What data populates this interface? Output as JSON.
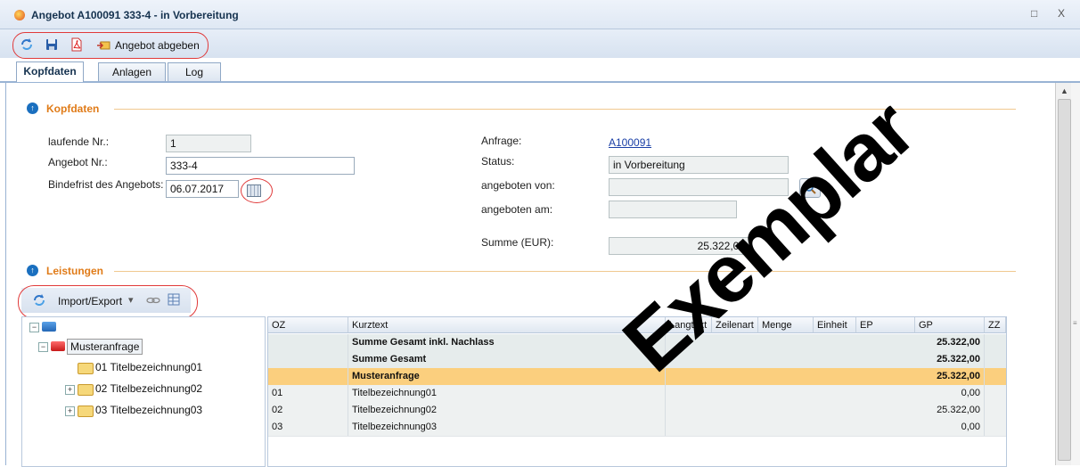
{
  "window": {
    "title": "Angebot A100091 333-4 - in Vorbereitung",
    "restore_glyph": "□",
    "close_glyph": "X"
  },
  "toolbar": {
    "submit_label": "Angebot abgeben",
    "icons": [
      "refresh-icon",
      "save-icon",
      "pdf-icon",
      "submit-offer-icon"
    ]
  },
  "tabs": [
    {
      "label": "Kopfdaten",
      "active": true
    },
    {
      "label": "Anlagen",
      "active": false
    },
    {
      "label": "Log",
      "active": false
    }
  ],
  "kopfdaten": {
    "section_title": "Kopfdaten",
    "laufende_nr_label": "laufende Nr.:",
    "laufende_nr_value": "1",
    "angebot_nr_label": "Angebot Nr.:",
    "angebot_nr_value": "333-4",
    "bindefrist_label": "Bindefrist des Angebots:",
    "bindefrist_value": "06.07.2017",
    "anfrage_label": "Anfrage:",
    "anfrage_value": "A100091",
    "status_label": "Status:",
    "status_value": "in Vorbereitung",
    "angeboten_von_label": "angeboten von:",
    "angeboten_von_value": "",
    "angeboten_am_label": "angeboten am:",
    "angeboten_am_value": "",
    "summe_label": "Summe (EUR):",
    "summe_value": "25.322,00"
  },
  "leistungen": {
    "section_title": "Leistungen",
    "import_export_label": "Import/Export",
    "dropdown_glyph": "▾",
    "tree": {
      "root_label": "Musteranfrage",
      "children": [
        "01 Titelbezeichnung01",
        "02 Titelbezeichnung02",
        "03 Titelbezeichnung03"
      ]
    },
    "grid": {
      "columns": [
        "OZ",
        "Kurztext",
        "Langtext",
        "Zeilenart",
        "Menge",
        "Einheit",
        "EP",
        "GP",
        "ZZ"
      ],
      "rows": [
        {
          "oz": "",
          "kurztext": "Summe Gesamt inkl. Nachlass",
          "gp": "25.322,00",
          "style": "sum"
        },
        {
          "oz": "",
          "kurztext": "Summe Gesamt",
          "gp": "25.322,00",
          "style": "sum"
        },
        {
          "oz": "",
          "kurztext": "Musteranfrage",
          "gp": "25.322,00",
          "style": "hl"
        },
        {
          "oz": "01",
          "kurztext": "Titelbezeichnung01",
          "gp": "0,00",
          "style": "norm"
        },
        {
          "oz": "02",
          "kurztext": "Titelbezeichnung02",
          "gp": "25.322,00",
          "style": "norm"
        },
        {
          "oz": "03",
          "kurztext": "Titelbezeichnung03",
          "gp": "0,00",
          "style": "norm"
        }
      ]
    }
  },
  "watermark": "Exemplar",
  "colors": {
    "section_title": "#e07b18",
    "highlight_row": "#fbcf7e",
    "annotation_red": "#e03a3a",
    "link": "#1a3fa6"
  }
}
